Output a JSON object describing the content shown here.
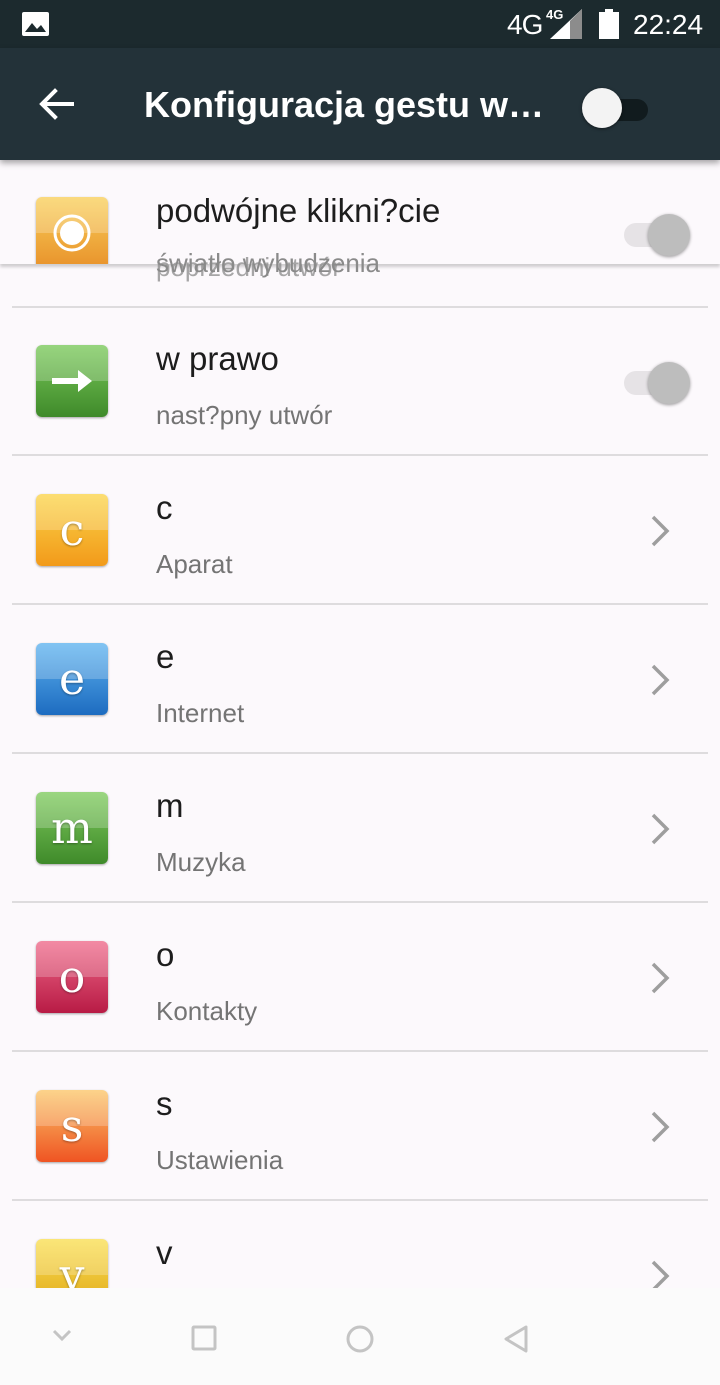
{
  "status_bar": {
    "network": "4G",
    "network_secondary": "4G",
    "time": "22:24",
    "icons": [
      "gallery-icon",
      "signal-icon",
      "battery-icon"
    ]
  },
  "toolbar": {
    "title": "Konfiguracja gestu wybudzania",
    "master_switch_on": false
  },
  "ghost_texts": [
    "światło wybudzenia",
    "poprzedni utwór"
  ],
  "items": [
    {
      "label": "podwójne klikni?cie",
      "sub": "",
      "control": "toggle",
      "on": false,
      "icon": "double-tap-icon",
      "color": "#f5a623"
    },
    {
      "label": "w prawo",
      "sub": "nast?pny utwór",
      "control": "toggle",
      "on": false,
      "icon": "arrow-right-icon",
      "color": "#5aa33e"
    },
    {
      "label": "c",
      "sub": "Aparat",
      "control": "chevron",
      "icon": "letter-c-icon",
      "glyph": "c",
      "color": "#f5a623"
    },
    {
      "label": "e",
      "sub": "Internet",
      "control": "chevron",
      "icon": "letter-e-icon",
      "glyph": "e",
      "color": "#2b80cf"
    },
    {
      "label": "m",
      "sub": "Muzyka",
      "control": "chevron",
      "icon": "letter-m-icon",
      "glyph": "m",
      "color": "#5aa33e"
    },
    {
      "label": "o",
      "sub": "Kontakty",
      "control": "chevron",
      "icon": "letter-o-icon",
      "glyph": "o",
      "color": "#d2355a"
    },
    {
      "label": "s",
      "sub": "Ustawienia",
      "control": "chevron",
      "icon": "letter-s-icon",
      "glyph": "s",
      "color": "#f47b31"
    },
    {
      "label": "v",
      "sub": "",
      "control": "chevron",
      "icon": "letter-v-icon",
      "glyph": "v",
      "color": "#e7b722"
    }
  ],
  "nav_bar": {
    "icons": [
      "hide-keyboard-icon",
      "recents-icon",
      "home-icon",
      "back-icon"
    ]
  }
}
